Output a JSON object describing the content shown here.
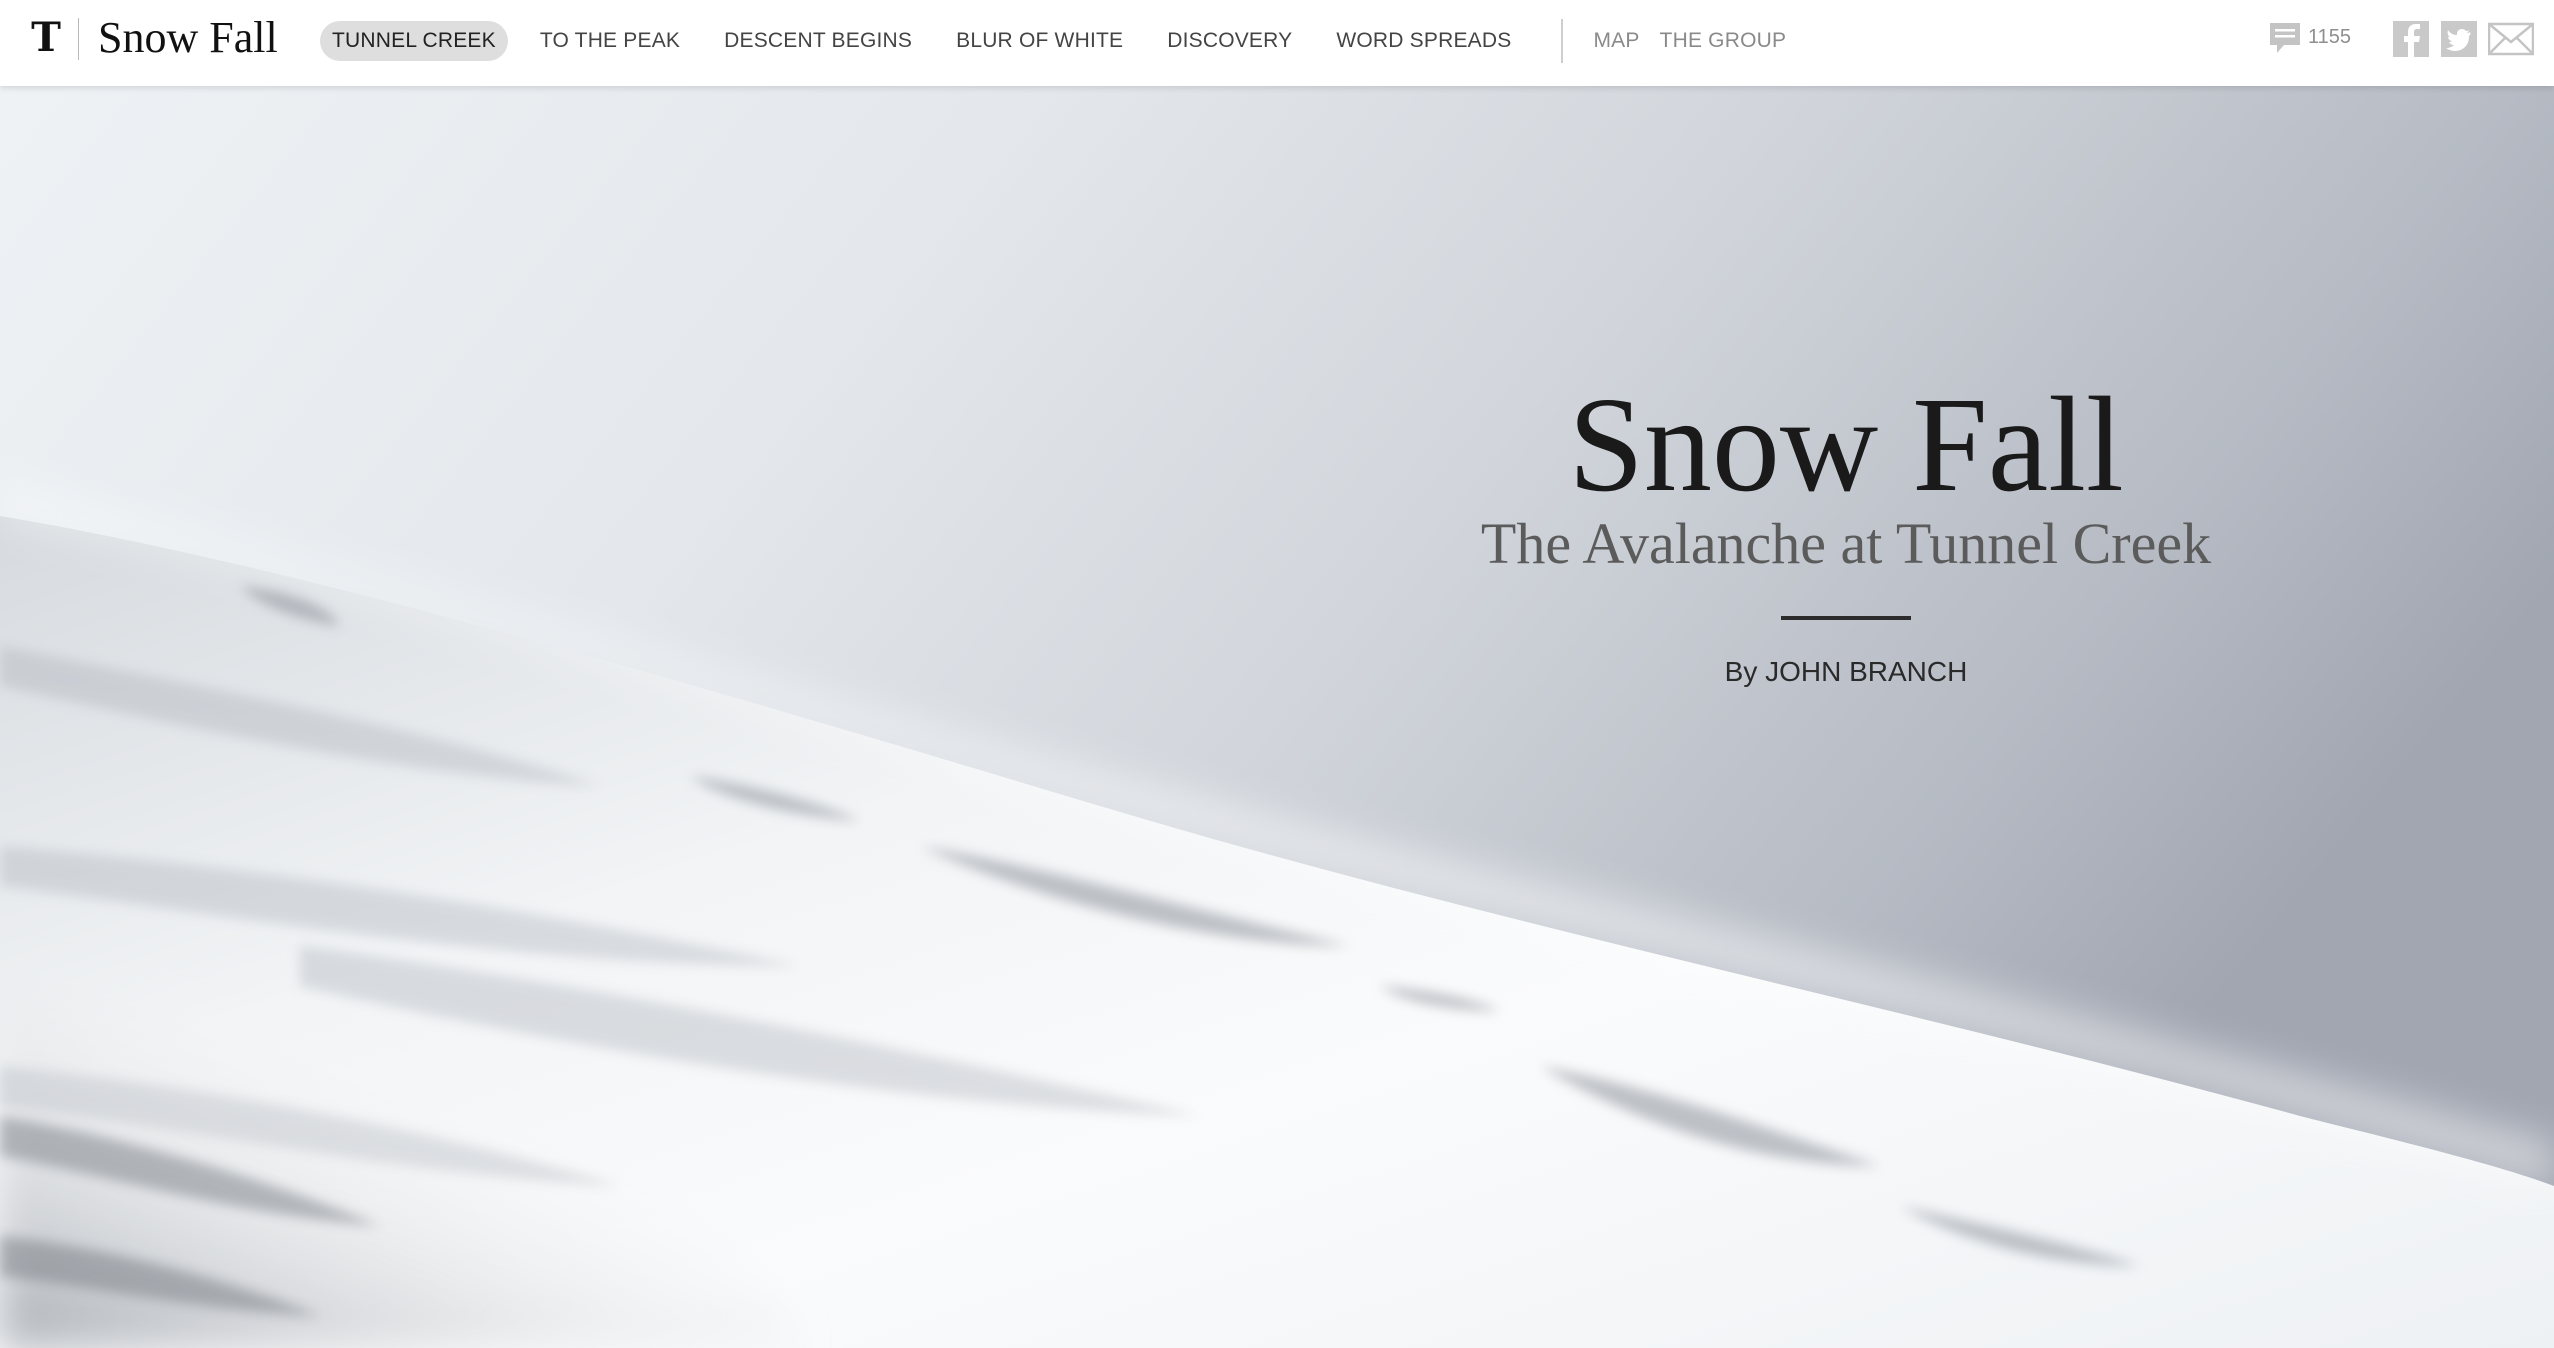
{
  "header": {
    "logo_glyph": "T",
    "brand_title": "Snow Fall",
    "nav": {
      "chapters": [
        {
          "label": "TUNNEL CREEK",
          "active": true
        },
        {
          "label": "TO THE PEAK",
          "active": false
        },
        {
          "label": "DESCENT BEGINS",
          "active": false
        },
        {
          "label": "BLUR OF WHITE",
          "active": false
        },
        {
          "label": "DISCOVERY",
          "active": false
        },
        {
          "label": "WORD SPREADS",
          "active": false
        }
      ],
      "extras": [
        {
          "label": "MAP"
        },
        {
          "label": "THE GROUP"
        }
      ]
    },
    "comments": {
      "icon": "comment-bubble-icon",
      "count": "1155"
    },
    "share": [
      {
        "icon": "facebook-icon",
        "color": "#b5b5b5"
      },
      {
        "icon": "twitter-icon",
        "color": "#b5b5b5"
      },
      {
        "icon": "email-icon",
        "color": "#b5b5b5"
      }
    ]
  },
  "hero": {
    "headline": "Snow Fall",
    "subhead": "The Avalanche at Tunnel Creek",
    "byline": "By JOHN BRANCH",
    "image": "snow-covered-slope-photo"
  },
  "colors": {
    "active_tab_bg": "#dedede",
    "headline": "#1a1a1a",
    "subhead": "#5b5b5b",
    "nav_text": "#444444",
    "nav_secondary_text": "#8a8a8a"
  }
}
